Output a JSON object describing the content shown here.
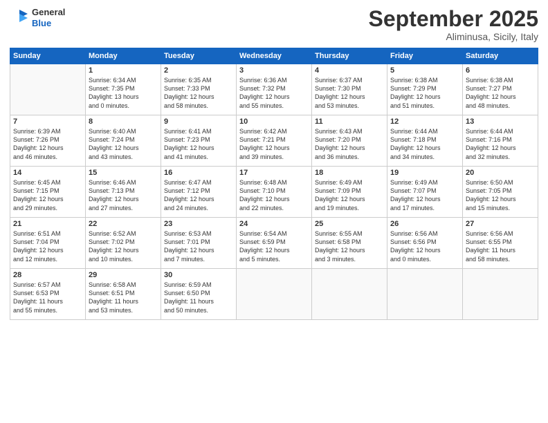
{
  "logo": {
    "general": "General",
    "blue": "Blue"
  },
  "header": {
    "month": "September 2025",
    "location": "Aliminusa, Sicily, Italy"
  },
  "days_of_week": [
    "Sunday",
    "Monday",
    "Tuesday",
    "Wednesday",
    "Thursday",
    "Friday",
    "Saturday"
  ],
  "weeks": [
    [
      {
        "day": "",
        "info": ""
      },
      {
        "day": "1",
        "info": "Sunrise: 6:34 AM\nSunset: 7:35 PM\nDaylight: 13 hours\nand 0 minutes."
      },
      {
        "day": "2",
        "info": "Sunrise: 6:35 AM\nSunset: 7:33 PM\nDaylight: 12 hours\nand 58 minutes."
      },
      {
        "day": "3",
        "info": "Sunrise: 6:36 AM\nSunset: 7:32 PM\nDaylight: 12 hours\nand 55 minutes."
      },
      {
        "day": "4",
        "info": "Sunrise: 6:37 AM\nSunset: 7:30 PM\nDaylight: 12 hours\nand 53 minutes."
      },
      {
        "day": "5",
        "info": "Sunrise: 6:38 AM\nSunset: 7:29 PM\nDaylight: 12 hours\nand 51 minutes."
      },
      {
        "day": "6",
        "info": "Sunrise: 6:38 AM\nSunset: 7:27 PM\nDaylight: 12 hours\nand 48 minutes."
      }
    ],
    [
      {
        "day": "7",
        "info": "Sunrise: 6:39 AM\nSunset: 7:26 PM\nDaylight: 12 hours\nand 46 minutes."
      },
      {
        "day": "8",
        "info": "Sunrise: 6:40 AM\nSunset: 7:24 PM\nDaylight: 12 hours\nand 43 minutes."
      },
      {
        "day": "9",
        "info": "Sunrise: 6:41 AM\nSunset: 7:23 PM\nDaylight: 12 hours\nand 41 minutes."
      },
      {
        "day": "10",
        "info": "Sunrise: 6:42 AM\nSunset: 7:21 PM\nDaylight: 12 hours\nand 39 minutes."
      },
      {
        "day": "11",
        "info": "Sunrise: 6:43 AM\nSunset: 7:20 PM\nDaylight: 12 hours\nand 36 minutes."
      },
      {
        "day": "12",
        "info": "Sunrise: 6:44 AM\nSunset: 7:18 PM\nDaylight: 12 hours\nand 34 minutes."
      },
      {
        "day": "13",
        "info": "Sunrise: 6:44 AM\nSunset: 7:16 PM\nDaylight: 12 hours\nand 32 minutes."
      }
    ],
    [
      {
        "day": "14",
        "info": "Sunrise: 6:45 AM\nSunset: 7:15 PM\nDaylight: 12 hours\nand 29 minutes."
      },
      {
        "day": "15",
        "info": "Sunrise: 6:46 AM\nSunset: 7:13 PM\nDaylight: 12 hours\nand 27 minutes."
      },
      {
        "day": "16",
        "info": "Sunrise: 6:47 AM\nSunset: 7:12 PM\nDaylight: 12 hours\nand 24 minutes."
      },
      {
        "day": "17",
        "info": "Sunrise: 6:48 AM\nSunset: 7:10 PM\nDaylight: 12 hours\nand 22 minutes."
      },
      {
        "day": "18",
        "info": "Sunrise: 6:49 AM\nSunset: 7:09 PM\nDaylight: 12 hours\nand 19 minutes."
      },
      {
        "day": "19",
        "info": "Sunrise: 6:49 AM\nSunset: 7:07 PM\nDaylight: 12 hours\nand 17 minutes."
      },
      {
        "day": "20",
        "info": "Sunrise: 6:50 AM\nSunset: 7:05 PM\nDaylight: 12 hours\nand 15 minutes."
      }
    ],
    [
      {
        "day": "21",
        "info": "Sunrise: 6:51 AM\nSunset: 7:04 PM\nDaylight: 12 hours\nand 12 minutes."
      },
      {
        "day": "22",
        "info": "Sunrise: 6:52 AM\nSunset: 7:02 PM\nDaylight: 12 hours\nand 10 minutes."
      },
      {
        "day": "23",
        "info": "Sunrise: 6:53 AM\nSunset: 7:01 PM\nDaylight: 12 hours\nand 7 minutes."
      },
      {
        "day": "24",
        "info": "Sunrise: 6:54 AM\nSunset: 6:59 PM\nDaylight: 12 hours\nand 5 minutes."
      },
      {
        "day": "25",
        "info": "Sunrise: 6:55 AM\nSunset: 6:58 PM\nDaylight: 12 hours\nand 3 minutes."
      },
      {
        "day": "26",
        "info": "Sunrise: 6:56 AM\nSunset: 6:56 PM\nDaylight: 12 hours\nand 0 minutes."
      },
      {
        "day": "27",
        "info": "Sunrise: 6:56 AM\nSunset: 6:55 PM\nDaylight: 11 hours\nand 58 minutes."
      }
    ],
    [
      {
        "day": "28",
        "info": "Sunrise: 6:57 AM\nSunset: 6:53 PM\nDaylight: 11 hours\nand 55 minutes."
      },
      {
        "day": "29",
        "info": "Sunrise: 6:58 AM\nSunset: 6:51 PM\nDaylight: 11 hours\nand 53 minutes."
      },
      {
        "day": "30",
        "info": "Sunrise: 6:59 AM\nSunset: 6:50 PM\nDaylight: 11 hours\nand 50 minutes."
      },
      {
        "day": "",
        "info": ""
      },
      {
        "day": "",
        "info": ""
      },
      {
        "day": "",
        "info": ""
      },
      {
        "day": "",
        "info": ""
      }
    ]
  ]
}
